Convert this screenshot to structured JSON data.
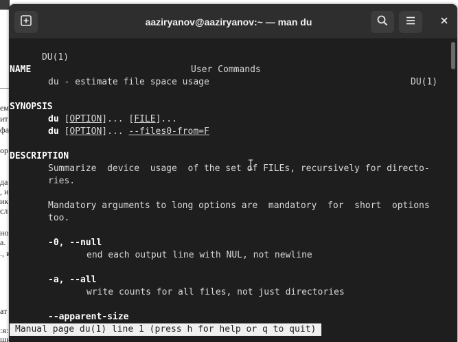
{
  "background_doc": {
    "lines": [
      "ем",
      "ит",
      "фа",
      "ор",
      "да",
      ", и",
      "ик",
      "сл",
      "но",
      "а.",
      "., в",
      "ат",
      ":я:",
      "щие выполнение лаб. раб.:"
    ]
  },
  "window": {
    "title": "aaziryanov@aaziryanov:~ — man du",
    "icons": {
      "new_tab": "new-tab-icon",
      "search": "search-icon",
      "menu": "hamburger-menu-icon",
      "close": "close-icon"
    }
  },
  "man": {
    "header_left": "DU(1)",
    "header_center": "User Commands",
    "header_right": "DU(1)",
    "name_heading": "NAME",
    "name_text": "du - estimate file space usage",
    "synopsis_heading": "SYNOPSIS",
    "syn1_cmd": "du",
    "syn1_opt": "OPTION",
    "syn1_file": "FILE",
    "syn2_cmd": "du",
    "syn2_opt": "OPTION",
    "syn2_files0": "--files0-from=F",
    "description_heading": "DESCRIPTION",
    "desc1": "Summarize  device  usage  of the set of FILEs, recursively for directo-",
    "desc2": "ries.",
    "desc3": "Mandatory arguments to long options are  mandatory  for  short  options",
    "desc4": "too.",
    "opt_null": "-0, --null",
    "opt_null_desc": "end each output line with NUL, not newline",
    "opt_all": "-a, --all",
    "opt_all_desc": "write counts for all files, not just directories",
    "opt_apparent": "--apparent-size"
  },
  "status_line": "Manual page du(1) line 1 (press h for help or q to quit)"
}
